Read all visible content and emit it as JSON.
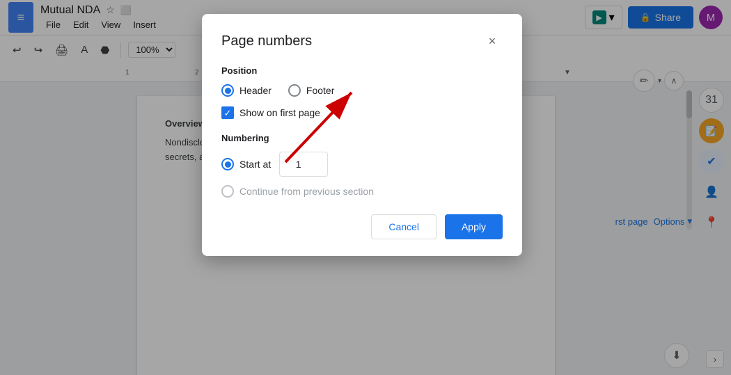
{
  "titleBar": {
    "docIcon": "≡",
    "docTitle": "Mutual NDA",
    "starIcon": "☆",
    "screenIcon": "⬜",
    "menus": [
      "File",
      "Edit",
      "View",
      "Insert"
    ],
    "meetLabel": "📹",
    "shareLabel": "Share",
    "avatarLabel": "M"
  },
  "toolbar": {
    "undoIcon": "↩",
    "redoIcon": "↪",
    "printIcon": "🖨",
    "paintIcon": "A",
    "formatPaintIcon": "⬣",
    "zoomValue": "100%",
    "zoomDropdown": "▾",
    "editPencilIcon": "✏",
    "chevronUpIcon": "∧"
  },
  "modal": {
    "title": "Page numbers",
    "closeIcon": "×",
    "positionLabel": "Position",
    "headerLabel": "Header",
    "footerLabel": "Footer",
    "showOnFirstPage": "Show on first page",
    "numberingLabel": "Numbering",
    "startAtLabel": "Start at",
    "startAtValue": "1",
    "continueLabel": "Continue from previous section",
    "cancelLabel": "Cancel",
    "applyLabel": "Apply"
  },
  "sidebar": {
    "calendarIcon": "31",
    "noteIcon": "📝",
    "taskIcon": "✔",
    "peopleIcon": "👤",
    "mapsIcon": "📍"
  },
  "docBody": {
    "overviewTitle": "Overview",
    "overviewText": "Nondisclosure agreements (also call increasingly important for businesses of all sizes, secrets, and hard work. These agree al"
  },
  "rightPanel": {
    "firstPageLabel": "rst page",
    "optionsLabel": "Options",
    "dropdownIcon": "▾"
  }
}
